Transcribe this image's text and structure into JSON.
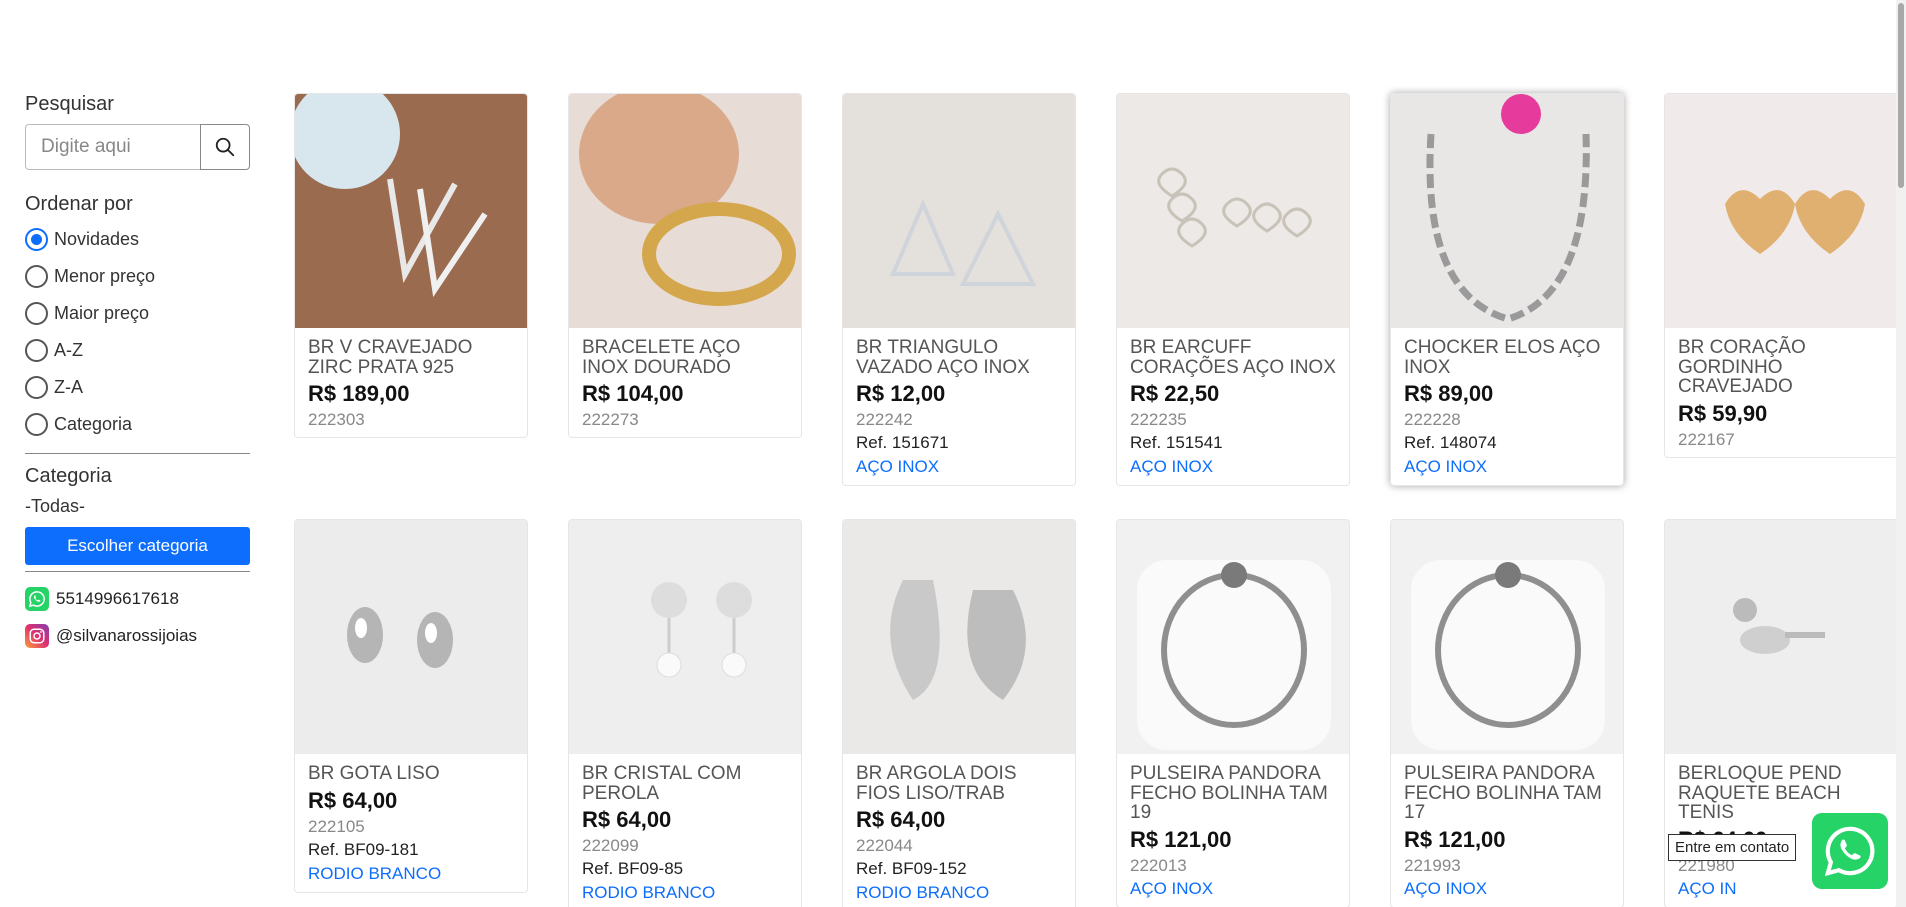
{
  "sidebar": {
    "search_heading": "Pesquisar",
    "search_placeholder": "Digite aqui",
    "order_heading": "Ordenar por",
    "order_options": [
      {
        "label": "Novidades",
        "checked": true
      },
      {
        "label": "Menor preço",
        "checked": false
      },
      {
        "label": "Maior preço",
        "checked": false
      },
      {
        "label": "A-Z",
        "checked": false
      },
      {
        "label": "Z-A",
        "checked": false
      },
      {
        "label": "Categoria",
        "checked": false
      }
    ],
    "category_heading": "Categoria",
    "category_value": "-Todas-",
    "category_button": "Escolher categoria",
    "whatsapp_number": "5514996617618",
    "instagram_handle": "@silvanarossijoias"
  },
  "products": [
    {
      "title": "BR V CRAVEJADO ZIRC PRATA 925",
      "price": "R$ 189,00",
      "code": "222303",
      "ref": "",
      "category": "",
      "image": "earring-v"
    },
    {
      "title": "BRACELETE AÇO INOX DOURADO",
      "price": "R$ 104,00",
      "code": "222273",
      "ref": "",
      "category": "",
      "image": "bangle-gold"
    },
    {
      "title": "BR TRIANGULO VAZADO AÇO INOX",
      "price": "R$ 12,00",
      "code": "222242",
      "ref": "Ref. 151671",
      "category": "AÇO INOX",
      "image": "earring-triangle"
    },
    {
      "title": "BR EARCUFF CORAÇÕES AÇO INOX",
      "price": "R$ 22,50",
      "code": "222235",
      "ref": "Ref. 151541",
      "category": "AÇO INOX",
      "image": "earcuff-hearts"
    },
    {
      "title": "CHOCKER ELOS AÇO INOX",
      "price": "R$ 89,00",
      "code": "222228",
      "ref": "Ref. 148074",
      "category": "AÇO INOX",
      "image": "choker-chain"
    },
    {
      "title": "BR CORAÇÃO GORDINHO CRAVEJADO",
      "price": "R$ 59,90",
      "code": "222167",
      "ref": "",
      "category": "",
      "image": "earring-heart-gold"
    },
    {
      "title": "BR GOTA LISO",
      "price": "R$ 64,00",
      "code": "222105",
      "ref": "Ref. BF09-181",
      "category": "RODIO BRANCO",
      "image": "earring-drop"
    },
    {
      "title": "BR CRISTAL COM PEROLA",
      "price": "R$ 64,00",
      "code": "222099",
      "ref": "Ref. BF09-85",
      "category": "RODIO BRANCO",
      "image": "earring-crystal-pearl"
    },
    {
      "title": "BR ARGOLA DOIS FIOS LISO/TRAB",
      "price": "R$ 64,00",
      "code": "222044",
      "ref": "Ref. BF09-152",
      "category": "RODIO BRANCO",
      "image": "hoop-double"
    },
    {
      "title": "PULSEIRA PANDORA FECHO BOLINHA TAM 19",
      "price": "R$ 121,00",
      "code": "222013",
      "ref": "",
      "category": "AÇO INOX",
      "image": "bracelet-pandora"
    },
    {
      "title": "PULSEIRA PANDORA FECHO BOLINHA TAM 17",
      "price": "R$ 121,00",
      "code": "221993",
      "ref": "",
      "category": "AÇO INOX",
      "image": "bracelet-pandora"
    },
    {
      "title": "BERLOQUE PEND RAQUETE BEACH TENIS",
      "price": "R$ 64,00",
      "code": "221980",
      "ref": "",
      "category": "AÇO IN",
      "image": "charm-racket"
    }
  ],
  "floating": {
    "tooltip": "Entre em contato"
  },
  "colors": {
    "accent": "#0d6efd",
    "whatsapp": "#25d366"
  }
}
